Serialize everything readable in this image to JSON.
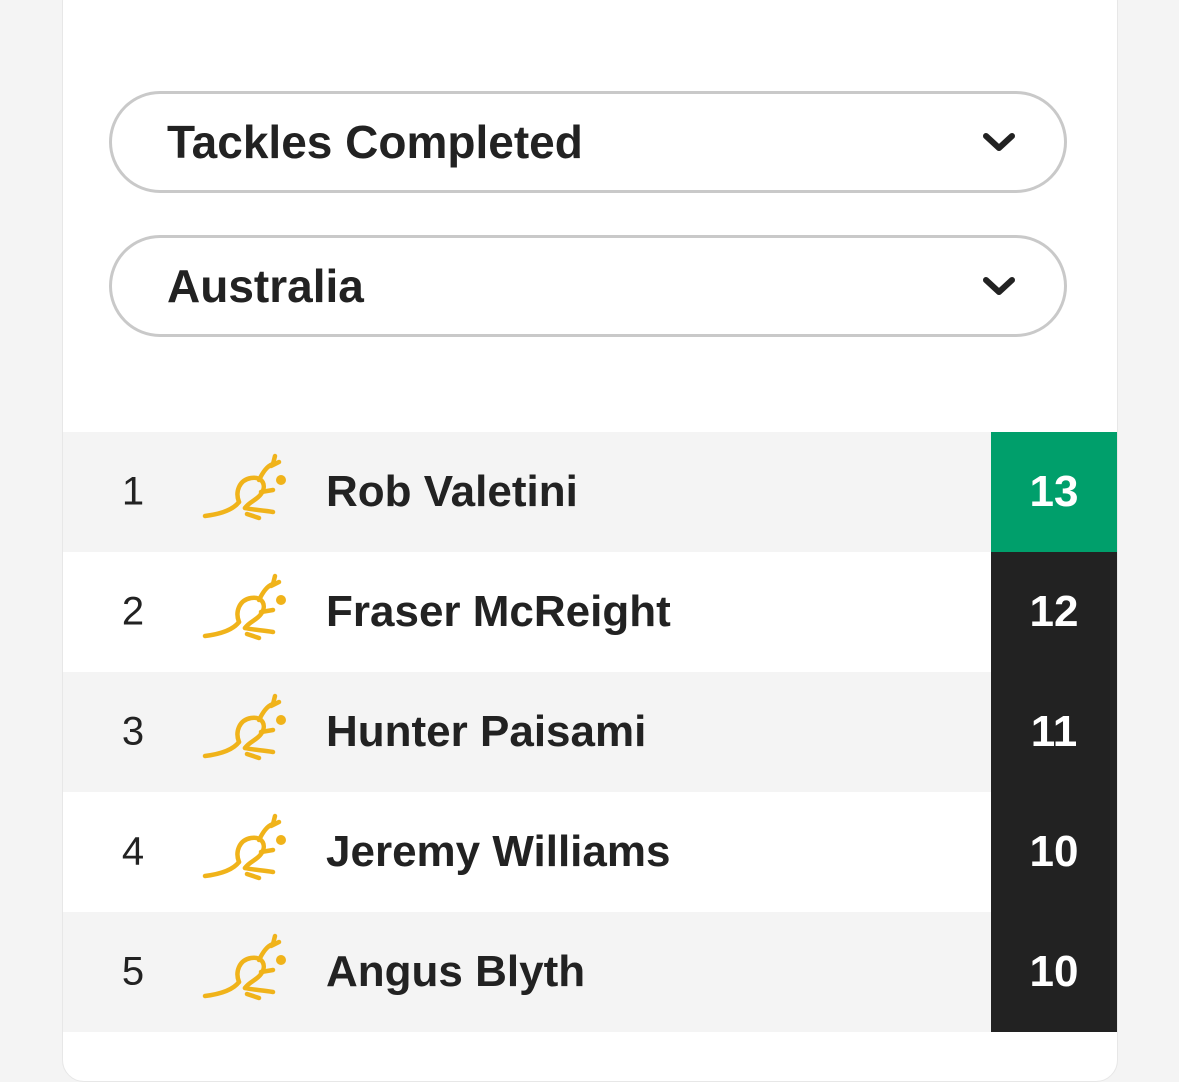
{
  "filters": {
    "stat": {
      "selected": "Tackles Completed",
      "icon": "chevron-down-icon"
    },
    "team": {
      "selected": "Australia",
      "icon": "chevron-down-icon"
    }
  },
  "leaderboard": {
    "team_logo_icon": "wallabies-kangaroo-logo",
    "colors": {
      "leader_score_bg": "#009f6b",
      "score_bg": "#222222",
      "logo_gold": "#f0b31a",
      "row_alt_bg": "#f4f4f4"
    },
    "rows": [
      {
        "rank": "1",
        "name": "Rob Valetini",
        "value": "13"
      },
      {
        "rank": "2",
        "name": "Fraser McReight",
        "value": "12"
      },
      {
        "rank": "3",
        "name": "Hunter Paisami",
        "value": "11"
      },
      {
        "rank": "4",
        "name": "Jeremy Williams",
        "value": "10"
      },
      {
        "rank": "5",
        "name": "Angus Blyth",
        "value": "10"
      }
    ]
  }
}
